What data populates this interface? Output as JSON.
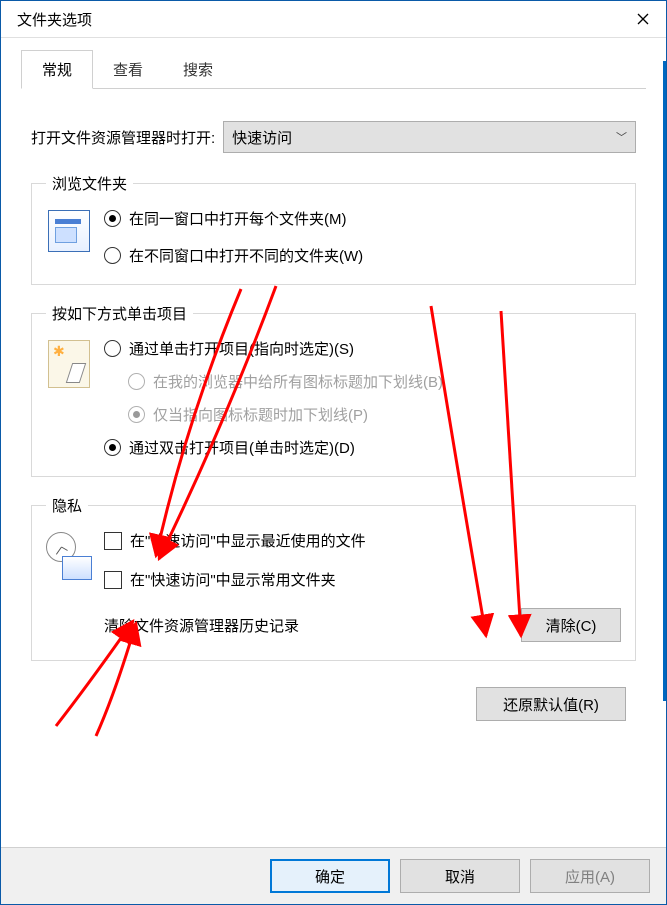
{
  "window": {
    "title": "文件夹选项"
  },
  "tabs": {
    "general": "常规",
    "view": "查看",
    "search": "搜索"
  },
  "open": {
    "label": "打开文件资源管理器时打开:",
    "selected": "快速访问"
  },
  "browse": {
    "legend": "浏览文件夹",
    "same_window": "在同一窗口中打开每个文件夹(M)",
    "own_window": "在不同窗口中打开不同的文件夹(W)"
  },
  "click": {
    "legend": "按如下方式单击项目",
    "single": "通过单击打开项目(指向时选定)(S)",
    "underline_all": "在我的浏览器中给所有图标标题加下划线(B)",
    "underline_point": "仅当指向图标标题时加下划线(P)",
    "double": "通过双击打开项目(单击时选定)(D)"
  },
  "privacy": {
    "legend": "隐私",
    "recent_files": "在\"快速访问\"中显示最近使用的文件",
    "frequent_folders": "在\"快速访问\"中显示常用文件夹",
    "clear_label": "清除文件资源管理器历史记录",
    "clear_btn": "清除(C)"
  },
  "restore": "还原默认值(R)",
  "buttons": {
    "ok": "确定",
    "cancel": "取消",
    "apply": "应用(A)"
  }
}
